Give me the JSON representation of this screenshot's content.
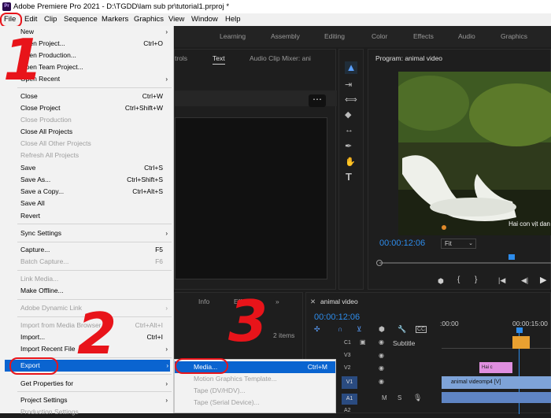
{
  "window": {
    "title": "Adobe Premiere Pro 2021 - D:\\TGDD\\lam sub pr\\tutorial1.prproj *",
    "logo": "Pr"
  },
  "menubar": [
    "File",
    "Edit",
    "Clip",
    "Sequence",
    "Markers",
    "Graphics",
    "View",
    "Window",
    "Help"
  ],
  "workspaces": [
    "Learning",
    "Assembly",
    "Editing",
    "Color",
    "Effects",
    "Audio",
    "Graphics"
  ],
  "file_menu": [
    {
      "label": "New",
      "shortcut": "",
      "submenu": true,
      "disabled": false
    },
    {
      "label": "Open Project...",
      "shortcut": "Ctrl+O",
      "submenu": false,
      "disabled": false
    },
    {
      "label": "Open Production...",
      "shortcut": "",
      "submenu": false,
      "disabled": false
    },
    {
      "label": "Open Team Project...",
      "shortcut": "",
      "submenu": false,
      "disabled": false
    },
    {
      "label": "Open Recent",
      "shortcut": "",
      "submenu": true,
      "disabled": false
    },
    {
      "label": "Close",
      "shortcut": "Ctrl+W",
      "submenu": false,
      "disabled": false
    },
    {
      "label": "Close Project",
      "shortcut": "Ctrl+Shift+W",
      "submenu": false,
      "disabled": false
    },
    {
      "label": "Close Production",
      "shortcut": "",
      "submenu": false,
      "disabled": true
    },
    {
      "label": "Close All Projects",
      "shortcut": "",
      "submenu": false,
      "disabled": false
    },
    {
      "label": "Close All Other Projects",
      "shortcut": "",
      "submenu": false,
      "disabled": true
    },
    {
      "label": "Refresh All Projects",
      "shortcut": "",
      "submenu": false,
      "disabled": true
    },
    {
      "label": "Save",
      "shortcut": "Ctrl+S",
      "submenu": false,
      "disabled": false
    },
    {
      "label": "Save As...",
      "shortcut": "Ctrl+Shift+S",
      "submenu": false,
      "disabled": false
    },
    {
      "label": "Save a Copy...",
      "shortcut": "Ctrl+Alt+S",
      "submenu": false,
      "disabled": false
    },
    {
      "label": "Save All",
      "shortcut": "",
      "submenu": false,
      "disabled": false
    },
    {
      "label": "Revert",
      "shortcut": "",
      "submenu": false,
      "disabled": false
    },
    {
      "label": "Sync Settings",
      "shortcut": "",
      "submenu": true,
      "disabled": false
    },
    {
      "label": "Capture...",
      "shortcut": "F5",
      "submenu": false,
      "disabled": false
    },
    {
      "label": "Batch Capture...",
      "shortcut": "F6",
      "submenu": false,
      "disabled": true
    },
    {
      "label": "Link Media...",
      "shortcut": "",
      "submenu": false,
      "disabled": true
    },
    {
      "label": "Make Offline...",
      "shortcut": "",
      "submenu": false,
      "disabled": false
    },
    {
      "label": "Adobe Dynamic Link",
      "shortcut": "",
      "submenu": true,
      "disabled": true
    },
    {
      "label": "Import from Media Browser",
      "shortcut": "Ctrl+Alt+I",
      "submenu": false,
      "disabled": true
    },
    {
      "label": "Import...",
      "shortcut": "Ctrl+I",
      "submenu": false,
      "disabled": false
    },
    {
      "label": "Import Recent File",
      "shortcut": "",
      "submenu": true,
      "disabled": false
    },
    {
      "label": "Export",
      "shortcut": "",
      "submenu": true,
      "disabled": false,
      "highlighted": true
    },
    {
      "label": "Get Properties for",
      "shortcut": "",
      "submenu": true,
      "disabled": false
    },
    {
      "label": "Project Settings",
      "shortcut": "",
      "submenu": true,
      "disabled": false
    },
    {
      "label": "Production Settings",
      "shortcut": "",
      "submenu": false,
      "disabled": true
    }
  ],
  "export_submenu": [
    {
      "label": "Media...",
      "shortcut": "Ctrl+M",
      "disabled": false,
      "highlighted": true
    },
    {
      "label": "Motion Graphics Template...",
      "shortcut": "",
      "disabled": true
    },
    {
      "label": "Tape (DV/HDV)...",
      "shortcut": "",
      "disabled": true
    },
    {
      "label": "Tape (Serial Device)...",
      "shortcut": "",
      "disabled": true
    }
  ],
  "source_panel": {
    "tabs": [
      "trols",
      "Text",
      "Audio Clip Mixer: ani"
    ]
  },
  "program_monitor": {
    "title": "Program: animal video",
    "timecode": "00:00:12:06",
    "fit": "Fit",
    "caption": "Hai con vịt dan"
  },
  "project_panel": {
    "tabs": [
      "Info",
      "Eff"
    ],
    "items_count": "2 items"
  },
  "timeline": {
    "tab": "animal video",
    "timecode": "00:00:12:06",
    "ruler": [
      ":00:00",
      "00:00:15:00"
    ],
    "tracks": [
      {
        "name": "C1",
        "label": "Subtitle"
      },
      {
        "name": "V3",
        "label": ""
      },
      {
        "name": "V2",
        "label": ""
      },
      {
        "name": "V1",
        "label": ""
      },
      {
        "name": "A1",
        "label": ""
      },
      {
        "name": "A2",
        "label": ""
      }
    ],
    "clips": {
      "v2": "Hai c",
      "v1": "animal videomp4 [V]"
    }
  },
  "annotations": [
    "1",
    "2",
    "3"
  ],
  "colors": {
    "menu_highlight": "#0a64d0",
    "annotation_red": "#e8141a",
    "timecode_blue": "#2d8ceb",
    "clip_v1": "#7ea3d8",
    "clip_v2": "#e08fe0",
    "caption_orange": "#e8a030"
  }
}
